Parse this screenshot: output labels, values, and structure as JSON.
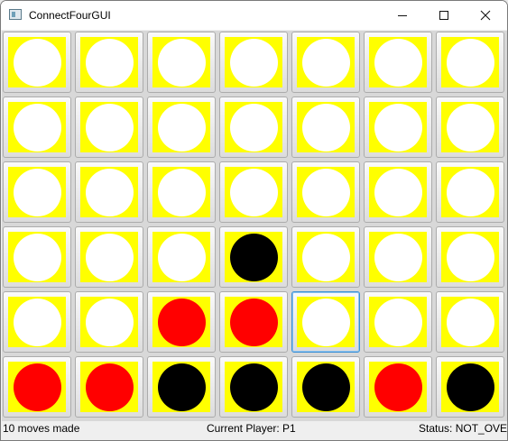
{
  "window": {
    "title": "ConnectFourGUI",
    "minimize_icon": "minimize-icon",
    "maximize_icon": "maximize-icon",
    "close_icon": "close-icon"
  },
  "board": {
    "rows": 6,
    "cols": 7,
    "cell_color": "#ffff00",
    "colors": {
      "empty": "#ffffff",
      "red": "#ff0000",
      "black": "#000000"
    },
    "cells": [
      [
        "empty",
        "empty",
        "empty",
        "empty",
        "empty",
        "empty",
        "empty"
      ],
      [
        "empty",
        "empty",
        "empty",
        "empty",
        "empty",
        "empty",
        "empty"
      ],
      [
        "empty",
        "empty",
        "empty",
        "empty",
        "empty",
        "empty",
        "empty"
      ],
      [
        "empty",
        "empty",
        "empty",
        "black",
        "empty",
        "empty",
        "empty"
      ],
      [
        "empty",
        "empty",
        "red",
        "red",
        "empty",
        "empty",
        "empty"
      ],
      [
        "red",
        "red",
        "black",
        "black",
        "black",
        "red",
        "black"
      ]
    ],
    "selected_cell": {
      "row": 4,
      "col": 4
    }
  },
  "status": {
    "moves": "10 moves made",
    "current_player": "Current Player: P1",
    "game_status": "Status: NOT_OVER"
  }
}
